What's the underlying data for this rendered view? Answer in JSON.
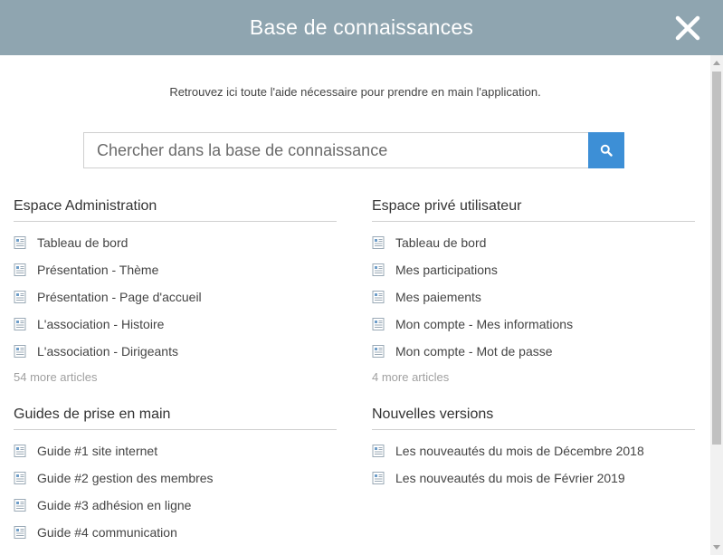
{
  "modal": {
    "title": "Base de connaissances",
    "intro": "Retrouvez ici toute l'aide nécessaire pour prendre en main l'application.",
    "search_placeholder": "Chercher dans la base de connaissance"
  },
  "sections": [
    {
      "title": "Espace Administration",
      "articles": [
        "Tableau de bord",
        "Présentation - Thème",
        "Présentation - Page d'accueil",
        "L'association - Histoire",
        "L'association - Dirigeants"
      ],
      "more": "54 more articles"
    },
    {
      "title": "Espace privé utilisateur",
      "articles": [
        "Tableau de bord",
        "Mes participations",
        "Mes paiements",
        "Mon compte - Mes informations",
        "Mon compte - Mot de passe"
      ],
      "more": "4 more articles"
    },
    {
      "title": "Guides de prise en main",
      "articles": [
        "Guide #1 site internet",
        "Guide #2 gestion des membres",
        "Guide #3 adhésion en ligne",
        "Guide #4 communication"
      ]
    },
    {
      "title": "Nouvelles versions",
      "articles": [
        "Les nouveautés du mois de Décembre 2018",
        "Les nouveautés du mois de Février 2019"
      ]
    }
  ],
  "colors": {
    "header_bg": "#8fa5b0",
    "search_button": "#3d8fd6",
    "doc_icon": "#6f9ec9"
  },
  "icons": {
    "close": "close-icon",
    "search": "search-icon",
    "article": "document-icon"
  }
}
